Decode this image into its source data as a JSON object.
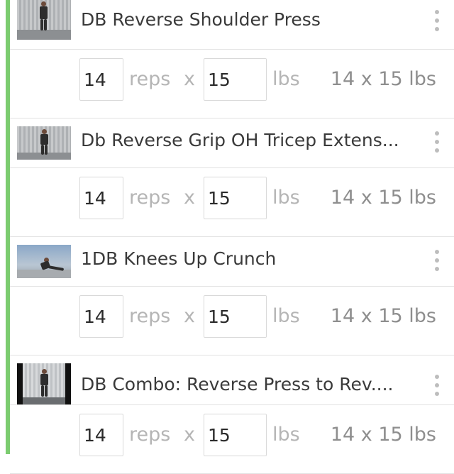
{
  "colors": {
    "accent": "#7ccc70",
    "text": "#3a3a3a",
    "muted": "#b5b5b5",
    "summary": "#8e8e8e",
    "divider": "#e3e3e3"
  },
  "exercises": [
    {
      "name": "DB Reverse Shoulder Press",
      "thumbnail": "standing",
      "set": {
        "reps": "14",
        "reps_label": "reps",
        "times": "x",
        "weight": "15",
        "unit": "lbs",
        "summary": "14 x 15 lbs"
      }
    },
    {
      "name": "Db Reverse Grip OH Tricep Extens...",
      "thumbnail": "standing",
      "set": {
        "reps": "14",
        "reps_label": "reps",
        "times": "x",
        "weight": "15",
        "unit": "lbs",
        "summary": "14 x 15 lbs"
      }
    },
    {
      "name": "1DB Knees Up Crunch",
      "thumbnail": "floor",
      "set": {
        "reps": "14",
        "reps_label": "reps",
        "times": "x",
        "weight": "15",
        "unit": "lbs",
        "summary": "14 x 15 lbs"
      }
    },
    {
      "name": "DB Combo: Reverse Press to Rev....",
      "thumbnail": "framed",
      "set": {
        "reps": "14",
        "reps_label": "reps",
        "times": "x",
        "weight": "15",
        "unit": "lbs",
        "summary": "14 x 15 lbs"
      }
    }
  ]
}
